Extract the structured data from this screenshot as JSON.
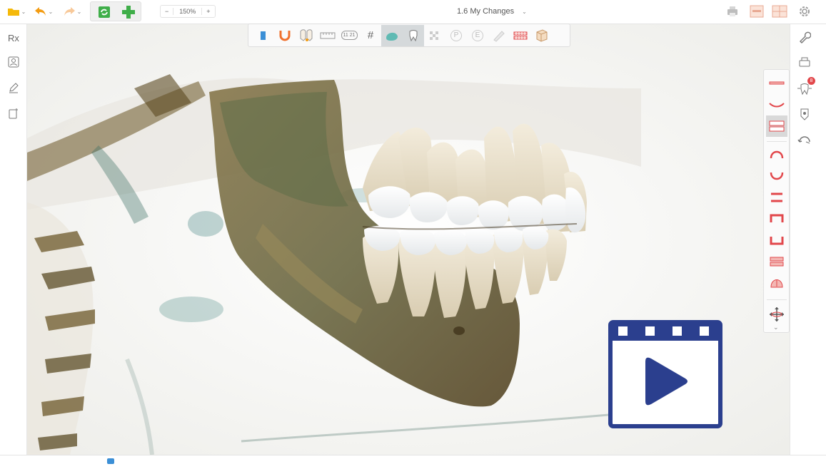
{
  "toolbar": {
    "zoom_minus": "−",
    "zoom_value": "150%",
    "zoom_plus": "+",
    "document_title": "1.6 My Changes"
  },
  "left_sidebar": {
    "prescription_label": "Rx"
  },
  "tool_palette": {
    "implant_numbers_label": "11 21",
    "grid_glyph": "#",
    "label_p": "P",
    "label_e": "E"
  },
  "right_sidebar": {
    "notification_count": "8"
  },
  "colors": {
    "accent_orange": "#f39c12",
    "folder_yellow": "#f5b90a",
    "sync_green": "#3fae49",
    "tooth_red": "#e2474b",
    "video_blue": "#2b3f8e",
    "bone_brown": "#7a5f2e",
    "tooth_cream": "#efe6d2"
  }
}
